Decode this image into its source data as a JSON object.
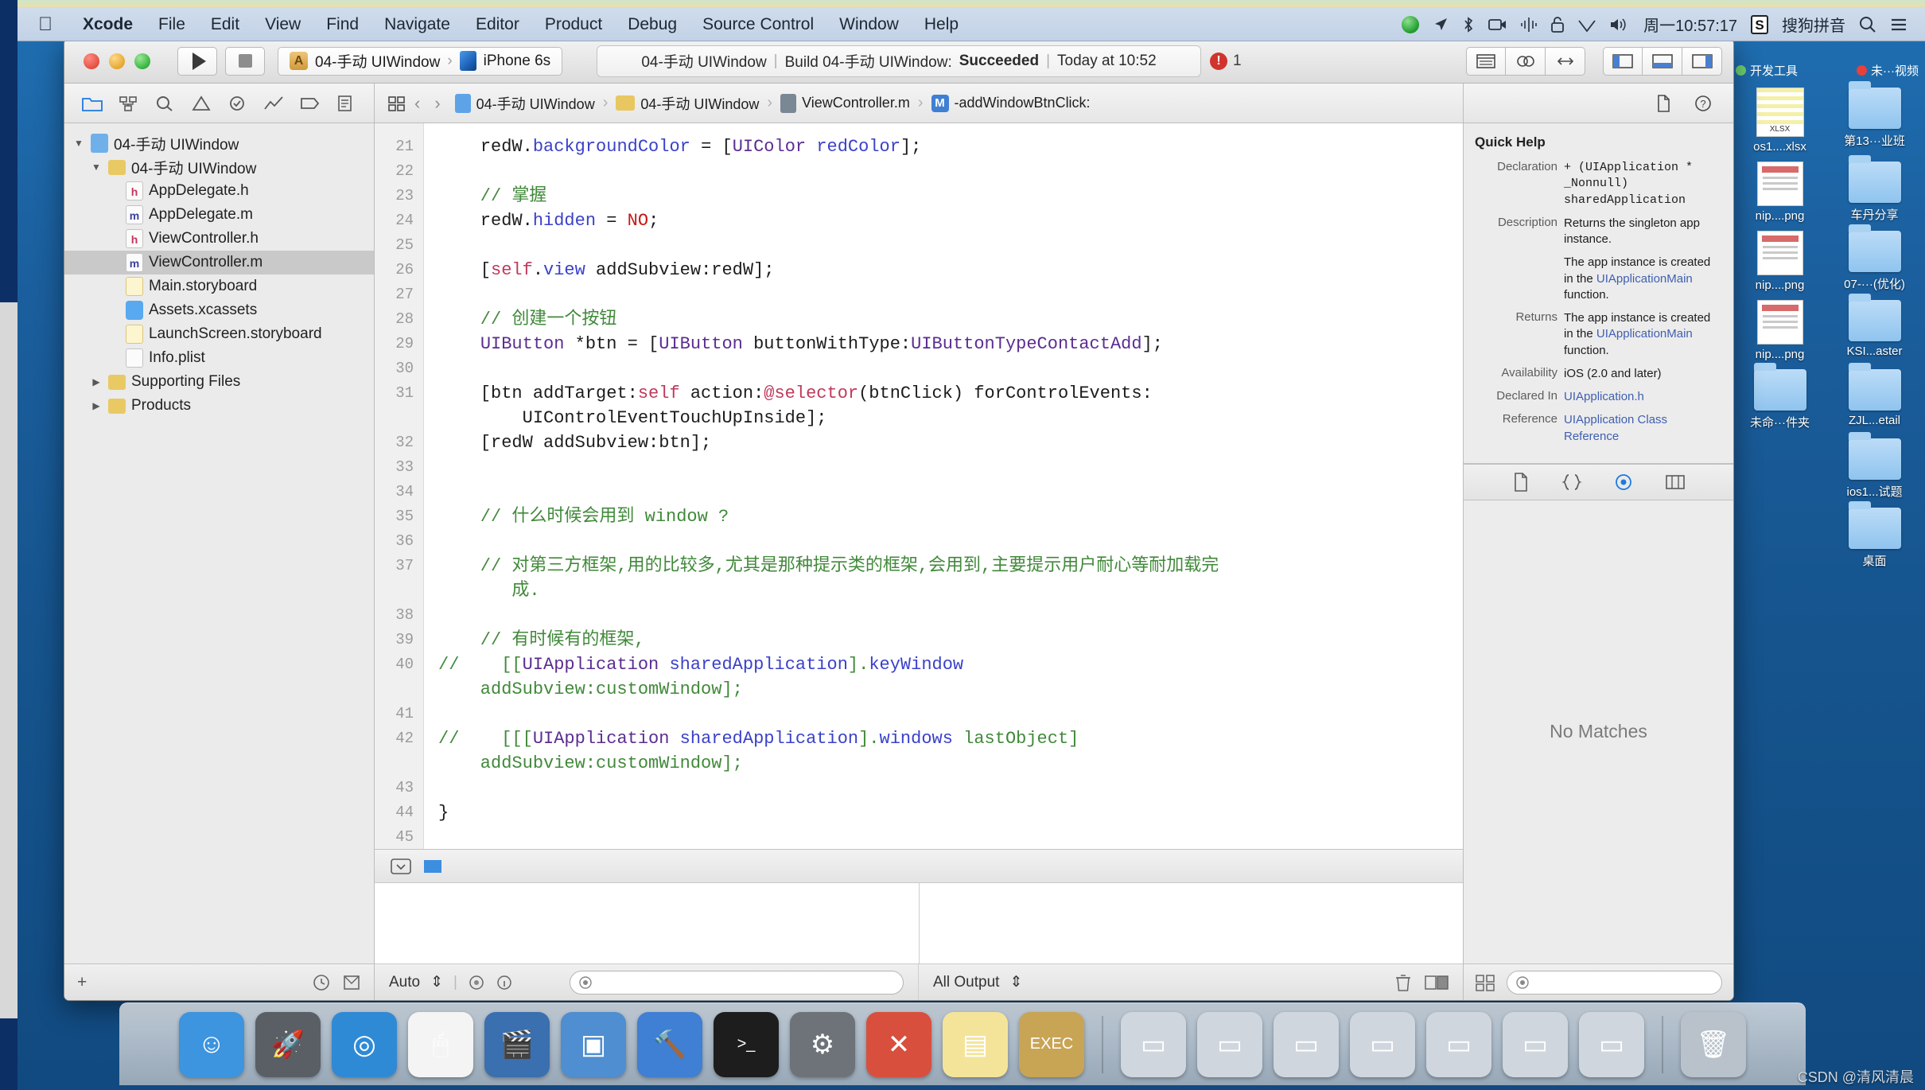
{
  "menubar": {
    "apple_icon": "apple-logo-icon",
    "items": [
      {
        "label": "Xcode",
        "bold": true
      },
      {
        "label": "File",
        "bold": false
      },
      {
        "label": "Edit",
        "bold": false
      },
      {
        "label": "View",
        "bold": false
      },
      {
        "label": "Find",
        "bold": false
      },
      {
        "label": "Navigate",
        "bold": false
      },
      {
        "label": "Editor",
        "bold": false
      },
      {
        "label": "Product",
        "bold": false
      },
      {
        "label": "Debug",
        "bold": false
      },
      {
        "label": "Source Control",
        "bold": false
      },
      {
        "label": "Window",
        "bold": false
      },
      {
        "label": "Help",
        "bold": false
      }
    ],
    "status": {
      "clock": "周一10:57:17",
      "input_method": "搜狗拼音",
      "sogou_badge": "S",
      "icons": [
        "record-indicator-icon",
        "location-arrow-icon",
        "bluetooth-icon",
        "screen-recording-icon",
        "audio-waveform-icon",
        "lock-icon",
        "wifi-icon",
        "volume-icon",
        "spotlight-search-icon",
        "notification-center-icon"
      ]
    }
  },
  "xcode": {
    "toolbar": {
      "run_icon": "play-icon",
      "stop_icon": "stop-icon",
      "scheme_name": "04-手动 UIWindow",
      "scheme_chevron": "›",
      "destination": "iPhone 6s",
      "activity": {
        "project": "04-手动 UIWindow",
        "sep1": "|",
        "build_text": "Build 04-手动 UIWindow:",
        "status": "Succeeded",
        "sep2": "|",
        "time": "Today at 10:52"
      },
      "issue_count": "1",
      "editor_buttons": [
        "standard-editor-icon",
        "assistant-editor-icon",
        "version-editor-icon"
      ],
      "panel_buttons": [
        "toggle-navigator-icon",
        "toggle-debug-area-icon",
        "toggle-inspector-icon"
      ]
    },
    "navigator": {
      "tabs": [
        "project-navigator-icon",
        "source-control-navigator-icon",
        "find-navigator-icon",
        "issue-navigator-icon",
        "test-navigator-icon",
        "debug-navigator-icon",
        "breakpoint-navigator-icon",
        "report-navigator-icon"
      ],
      "active_tab": 0,
      "tree": [
        {
          "label": "04-手动 UIWindow",
          "indent": 0,
          "twisty": "▼",
          "icon": "project-icon",
          "selected": false
        },
        {
          "label": "04-手动 UIWindow",
          "indent": 1,
          "twisty": "▼",
          "icon": "folder-icon",
          "selected": false
        },
        {
          "label": "AppDelegate.h",
          "indent": 2,
          "twisty": "",
          "icon": "header-file-icon",
          "selected": false
        },
        {
          "label": "AppDelegate.m",
          "indent": 2,
          "twisty": "",
          "icon": "implementation-file-icon",
          "selected": false
        },
        {
          "label": "ViewController.h",
          "indent": 2,
          "twisty": "",
          "icon": "header-file-icon",
          "selected": false
        },
        {
          "label": "ViewController.m",
          "indent": 2,
          "twisty": "",
          "icon": "implementation-file-icon",
          "selected": true
        },
        {
          "label": "Main.storyboard",
          "indent": 2,
          "twisty": "",
          "icon": "storyboard-file-icon",
          "selected": false
        },
        {
          "label": "Assets.xcassets",
          "indent": 2,
          "twisty": "",
          "icon": "assets-catalog-icon",
          "selected": false
        },
        {
          "label": "LaunchScreen.storyboard",
          "indent": 2,
          "twisty": "",
          "icon": "storyboard-file-icon",
          "selected": false
        },
        {
          "label": "Info.plist",
          "indent": 2,
          "twisty": "",
          "icon": "plist-file-icon",
          "selected": false
        },
        {
          "label": "Supporting Files",
          "indent": 1,
          "twisty": "▶",
          "icon": "folder-icon",
          "selected": false
        },
        {
          "label": "Products",
          "indent": 1,
          "twisty": "▶",
          "icon": "folder-icon",
          "selected": false
        }
      ],
      "footer": {
        "add_label": "+",
        "filter_icon": "filter-icon"
      }
    },
    "jumpbar": {
      "related_items_icon": "related-items-icon",
      "back_icon": "‹",
      "forward_icon": "›",
      "crumbs": [
        {
          "label": "04-手动 UIWindow",
          "icon": "project-icon"
        },
        {
          "label": "04-手动 UIWindow",
          "icon": "folder-icon"
        },
        {
          "label": "ViewController.m",
          "icon": "implementation-file-icon"
        },
        {
          "label": "-addWindowBtnClick:",
          "icon": "method-badge-icon"
        }
      ],
      "separator": "›"
    },
    "code": {
      "first_line": 21,
      "lines": [
        {
          "no": 21,
          "tokens": [
            {
              "t": "    ",
              "c": "plain"
            },
            {
              "t": "redW",
              "c": "plain"
            },
            {
              "t": ".",
              "c": "plain"
            },
            {
              "t": "backgroundColor",
              "c": "prop"
            },
            {
              "t": " = [",
              "c": "plain"
            },
            {
              "t": "UIColor",
              "c": "type"
            },
            {
              "t": " ",
              "c": "plain"
            },
            {
              "t": "redColor",
              "c": "prop"
            },
            {
              "t": "];",
              "c": "plain"
            }
          ]
        },
        {
          "no": 22,
          "tokens": []
        },
        {
          "no": 23,
          "tokens": [
            {
              "t": "    // 掌握",
              "c": "com"
            }
          ]
        },
        {
          "no": 24,
          "tokens": [
            {
              "t": "    redW.",
              "c": "plain"
            },
            {
              "t": "hidden",
              "c": "prop"
            },
            {
              "t": " = ",
              "c": "plain"
            },
            {
              "t": "NO",
              "c": "num"
            },
            {
              "t": ";",
              "c": "plain"
            }
          ]
        },
        {
          "no": 25,
          "tokens": []
        },
        {
          "no": 26,
          "tokens": [
            {
              "t": "    [",
              "c": "plain"
            },
            {
              "t": "self",
              "c": "self"
            },
            {
              "t": ".",
              "c": "plain"
            },
            {
              "t": "view",
              "c": "prop"
            },
            {
              "t": " addSubview:redW];",
              "c": "plain"
            }
          ]
        },
        {
          "no": 27,
          "tokens": []
        },
        {
          "no": 28,
          "tokens": [
            {
              "t": "    // 创建一个按钮",
              "c": "com"
            }
          ]
        },
        {
          "no": 29,
          "tokens": [
            {
              "t": "    ",
              "c": "plain"
            },
            {
              "t": "UIButton",
              "c": "type"
            },
            {
              "t": " *btn = [",
              "c": "plain"
            },
            {
              "t": "UIButton",
              "c": "type"
            },
            {
              "t": " buttonWithType:",
              "c": "plain"
            },
            {
              "t": "UIButtonTypeContactAdd",
              "c": "type"
            },
            {
              "t": "];",
              "c": "plain"
            }
          ]
        },
        {
          "no": 30,
          "tokens": []
        },
        {
          "no": 31,
          "wrap": true,
          "tokens": [
            {
              "t": "    [btn addTarget:",
              "c": "plain"
            },
            {
              "t": "self",
              "c": "self"
            },
            {
              "t": " action:",
              "c": "plain"
            },
            {
              "t": "@selector",
              "c": "sel"
            },
            {
              "t": "(btnClick) forControlEvents:",
              "c": "plain"
            },
            {
              "t": "\n        UIControlEventTouchUpInside];",
              "c": "plain"
            }
          ]
        },
        {
          "no": 32,
          "tokens": [
            {
              "t": "    [redW addSubview:btn];",
              "c": "plain"
            }
          ]
        },
        {
          "no": 33,
          "tokens": []
        },
        {
          "no": 34,
          "tokens": []
        },
        {
          "no": 35,
          "tokens": [
            {
              "t": "    // 什么时候会用到 window ?",
              "c": "com"
            }
          ]
        },
        {
          "no": 36,
          "tokens": []
        },
        {
          "no": 37,
          "wrap": true,
          "tokens": [
            {
              "t": "    // 对第三方框架,用的比较多,尤其是那种提示类的框架,会用到,主要提示用户耐心等耐加载完\n       成.",
              "c": "com"
            }
          ]
        },
        {
          "no": 38,
          "tokens": []
        },
        {
          "no": 39,
          "tokens": [
            {
              "t": "    // 有时候有的框架,",
              "c": "com"
            }
          ]
        },
        {
          "no": 40,
          "wrap": true,
          "tokens": [
            {
              "t": "//    [[",
              "c": "com"
            },
            {
              "t": "UIApplication",
              "c": "type"
            },
            {
              "t": " ",
              "c": "com"
            },
            {
              "t": "sharedApplication",
              "c": "prop"
            },
            {
              "t": "].",
              "c": "com"
            },
            {
              "t": "keyWindow",
              "c": "prop"
            },
            {
              "t": "\n    addSubview:customWindow];",
              "c": "com"
            }
          ]
        },
        {
          "no": 41,
          "tokens": []
        },
        {
          "no": 42,
          "wrap": true,
          "tokens": [
            {
              "t": "//    [[[",
              "c": "com"
            },
            {
              "t": "UIApplication",
              "c": "type"
            },
            {
              "t": " ",
              "c": "com"
            },
            {
              "t": "sharedApplication",
              "c": "prop"
            },
            {
              "t": "].",
              "c": "com"
            },
            {
              "t": "windows",
              "c": "prop"
            },
            {
              "t": " lastObject]\n    addSubview:customWindow];",
              "c": "com"
            }
          ]
        },
        {
          "no": 43,
          "tokens": []
        },
        {
          "no": 44,
          "tokens": [
            {
              "t": "}",
              "c": "plain"
            }
          ]
        },
        {
          "no": 45,
          "tokens": []
        }
      ]
    },
    "debug_area": {
      "bottom_left_popup": "Auto",
      "bottom_right_popup": "All Output",
      "filter_placeholder": "",
      "icons": [
        "trash-icon",
        "split-panes-icon",
        "console-toggle-icon",
        "variables-toggle-icon"
      ]
    },
    "inspector": {
      "title": "Quick Help",
      "rows": [
        {
          "label": "Declaration",
          "value": "+ (UIApplication * _Nonnull) sharedApplication",
          "mono": true,
          "link": false
        },
        {
          "label": "Description",
          "value": "Returns the singleton app instance.",
          "mono": false,
          "link": false
        },
        {
          "label": "",
          "value": "The app instance is created in the UIApplicationMain function.",
          "mono": false,
          "link": true,
          "link_text": "UIApplicationMain"
        },
        {
          "label": "Returns",
          "value": "The app instance is created in the UIApplicationMain function.",
          "mono": false,
          "link": true,
          "link_text": "UIApplicationMain"
        },
        {
          "label": "Availability",
          "value": "iOS (2.0 and later)",
          "mono": false,
          "link": false
        },
        {
          "label": "Declared In",
          "value": "UIApplication.h",
          "mono": false,
          "link": true,
          "link_text": "UIApplication.h"
        },
        {
          "label": "Reference",
          "value": "UIApplication Class Reference",
          "mono": false,
          "link": true,
          "link_text": "UIApplication Class Reference"
        }
      ],
      "library_tabs": [
        "file-template-library-icon",
        "code-snippet-library-icon",
        "object-library-icon",
        "media-library-icon"
      ],
      "active_library_tab": 2,
      "library_empty_text": "No Matches",
      "footer_filter_placeholder": ""
    }
  },
  "desktop": {
    "top_tags": [
      {
        "label": "开发工具",
        "color": "#6fd36f"
      },
      {
        "label": "未···视频",
        "color": "#e8403b"
      }
    ],
    "icons": [
      {
        "label": "os1....xlsx",
        "type": "xlsx"
      },
      {
        "label": "第13···业班",
        "type": "folder"
      },
      {
        "label": "nip....png",
        "type": "png"
      },
      {
        "label": "车丹分享",
        "type": "folder"
      },
      {
        "label": "nip....png",
        "type": "png"
      },
      {
        "label": "07-···(优化)",
        "type": "folder"
      },
      {
        "label": "nip....png",
        "type": "png"
      },
      {
        "label": "KSI...aster",
        "type": "folder"
      },
      {
        "label": "未命···件夹",
        "type": "folder"
      },
      {
        "label": "ZJL...etail",
        "type": "folder"
      },
      {
        "label": "",
        "type": "none"
      },
      {
        "label": "ios1...试题",
        "type": "folder"
      },
      {
        "label": "",
        "type": "none"
      },
      {
        "label": "桌面",
        "type": "folder"
      }
    ]
  },
  "dock": {
    "items": [
      {
        "name": "finder",
        "color": "#3d94df",
        "glyph": "☺"
      },
      {
        "name": "launchpad",
        "color": "#5a5f66",
        "glyph": "🚀"
      },
      {
        "name": "safari",
        "color": "#2f8ad6",
        "glyph": "◎"
      },
      {
        "name": "mouse-app",
        "color": "#f4f4f4",
        "glyph": "🖱"
      },
      {
        "name": "quicktime",
        "color": "#3a6fb0",
        "glyph": "🎬"
      },
      {
        "name": "simulator",
        "color": "#4f8ed0",
        "glyph": "▣"
      },
      {
        "name": "xcode",
        "color": "#3f7fd4",
        "glyph": "🔨"
      },
      {
        "name": "terminal",
        "color": "#1d1d1d",
        "glyph": ">_"
      },
      {
        "name": "system-preferences",
        "color": "#6e7379",
        "glyph": "⚙"
      },
      {
        "name": "charles-proxy",
        "color": "#d94f3d",
        "glyph": "✕"
      },
      {
        "name": "notes",
        "color": "#f4e49a",
        "glyph": "▤"
      },
      {
        "name": "executable-app",
        "color": "#c8a455",
        "glyph": "EXEC"
      },
      {
        "name": "window-1",
        "color": "#cfd6de",
        "glyph": "▭"
      },
      {
        "name": "window-2",
        "color": "#cfd6de",
        "glyph": "▭"
      },
      {
        "name": "window-3",
        "color": "#cfd6de",
        "glyph": "▭"
      },
      {
        "name": "window-4",
        "color": "#cfd6de",
        "glyph": "▭"
      },
      {
        "name": "window-5",
        "color": "#cfd6de",
        "glyph": "▭"
      },
      {
        "name": "window-6",
        "color": "#cfd6de",
        "glyph": "▭"
      },
      {
        "name": "window-7",
        "color": "#cfd6de",
        "glyph": "▭"
      },
      {
        "name": "trash",
        "color": "#b9c2cb",
        "glyph": "🗑"
      }
    ]
  },
  "watermark": "CSDN @清风清晨"
}
